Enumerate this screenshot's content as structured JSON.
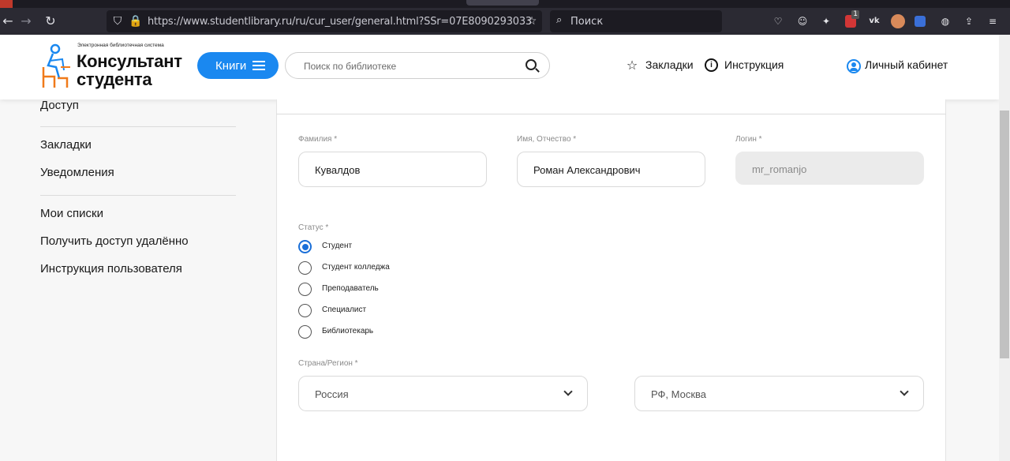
{
  "browser": {
    "url": "https://www.studentlibrary.ru/ru/cur_user/general.html?SSr=07E8090293033",
    "search_placeholder": "Поиск",
    "extension_badge": "1",
    "icons": [
      "back-icon",
      "forward-icon",
      "reload-icon",
      "shield-icon",
      "lock-icon",
      "star-icon",
      "pocket-icon",
      "account-icon",
      "extension-icon",
      "vk-icon",
      "translate-icon",
      "globe-icon",
      "share-icon",
      "menu-icon"
    ]
  },
  "site": {
    "logo_tagline": "Электронная библиотечная система",
    "logo_line1": "Консультант",
    "logo_line2": "студента",
    "books_button": "Книги",
    "search_placeholder": "Поиск по библиотеке",
    "bookmarks_link": "Закладки",
    "instructions_link": "Инструкция",
    "cabinet_link": "Личный кабинет",
    "accent_color": "#1a88f0"
  },
  "sidebar": {
    "items": [
      {
        "label": "Доступ"
      },
      {
        "label": "Закладки"
      },
      {
        "label": "Уведомления"
      },
      {
        "label": "Мои списки"
      },
      {
        "label": "Получить доступ удалённо"
      },
      {
        "label": "Инструкция пользователя"
      }
    ]
  },
  "form": {
    "lastname_label": "Фамилия *",
    "lastname_value": "Кувалдов",
    "name_label": "Имя, Отчество *",
    "name_value": "Роман Александрович",
    "login_label": "Логин *",
    "login_value": "mr_romanjo",
    "status_label": "Статус *",
    "status_options": [
      {
        "label": "Студент",
        "checked": true
      },
      {
        "label": "Студент колледжа",
        "checked": false
      },
      {
        "label": "Преподаватель",
        "checked": false
      },
      {
        "label": "Специалист",
        "checked": false
      },
      {
        "label": "Библиотекарь",
        "checked": false
      }
    ],
    "region_label": "Страна/Регион *",
    "country_value": "Россия",
    "region_value": "РФ, Москва"
  }
}
